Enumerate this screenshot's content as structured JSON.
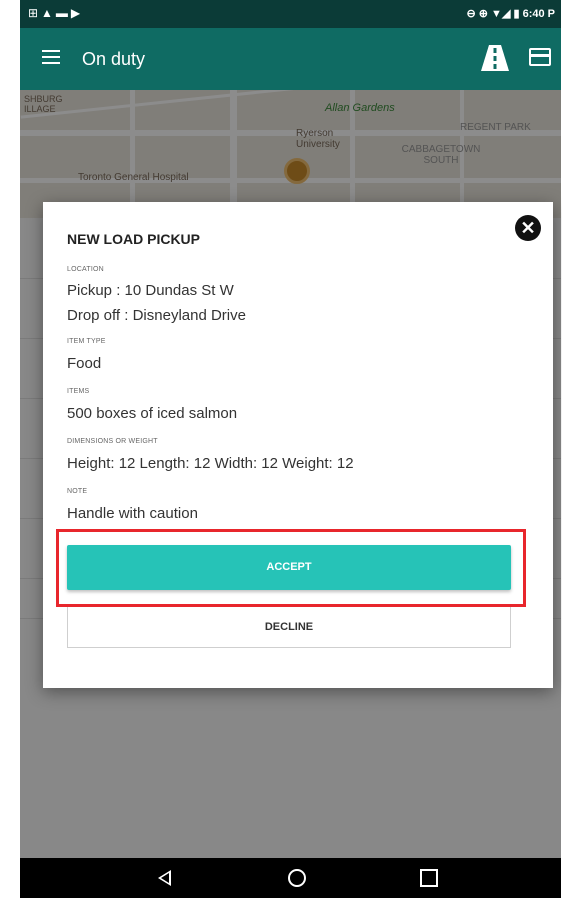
{
  "status_bar": {
    "time": "6:40 P"
  },
  "app_bar": {
    "title": "On duty"
  },
  "map": {
    "labels": [
      "SHBURG ILLAGE",
      "Allan Gardens",
      "Ryerson University",
      "REGENT PARK",
      "CABBAGETOWN SOUTH",
      "Toronto General Hospital"
    ]
  },
  "dialog": {
    "title": "NEW LOAD PICKUP",
    "sections": [
      {
        "label": "LOCATION",
        "lines": [
          "Pickup : 10 Dundas St W",
          "Drop off : Disneyland Drive"
        ]
      },
      {
        "label": "ITEM TYPE",
        "lines": [
          "Food"
        ]
      },
      {
        "label": "ITEMS",
        "lines": [
          "500 boxes of iced salmon"
        ]
      },
      {
        "label": "DIMENSIONS OR WEIGHT",
        "lines": [
          "Height: 12 Length: 12 Width: 12 Weight: 12"
        ]
      },
      {
        "label": "NOTE",
        "lines": [
          "Handle with caution"
        ]
      }
    ],
    "accept_label": "ACCEPT",
    "decline_label": "DECLINE",
    "close_icon": "✕"
  },
  "colors": {
    "app_bar": "#0f6b63",
    "status_bar": "#0b3b37",
    "accept": "#26c3b7",
    "highlight": "#e8262c"
  },
  "icons": [
    "menu-icon",
    "road-icon",
    "card-icon",
    "close-icon",
    "back-icon",
    "home-icon",
    "recent-apps-icon"
  ]
}
